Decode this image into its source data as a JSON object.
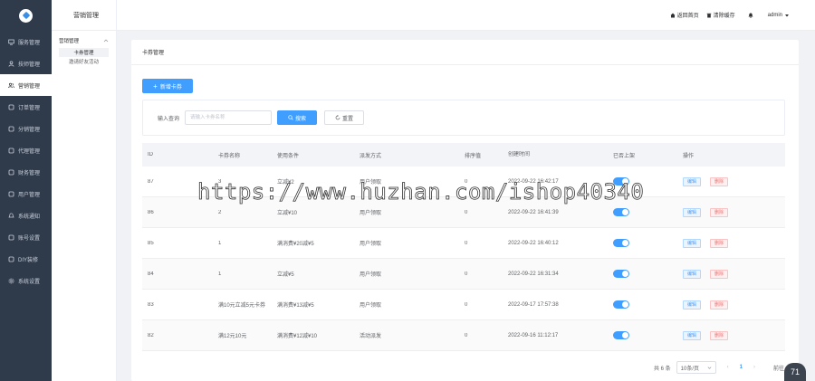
{
  "sidebar": {
    "items": [
      {
        "label": "服务管理",
        "icon": "monitor-icon"
      },
      {
        "label": "技师管理",
        "icon": "user-icon"
      },
      {
        "label": "营销管理",
        "icon": "people-icon",
        "active": true
      },
      {
        "label": "订单管理",
        "icon": "order-icon"
      },
      {
        "label": "分销管理",
        "icon": "share-icon"
      },
      {
        "label": "代理管理",
        "icon": "agent-icon"
      },
      {
        "label": "财务管理",
        "icon": "finance-icon"
      },
      {
        "label": "用户管理",
        "icon": "customer-icon"
      },
      {
        "label": "系统通知",
        "icon": "bell-icon"
      },
      {
        "label": "账号设置",
        "icon": "account-icon"
      },
      {
        "label": "DIY装修",
        "icon": "diy-icon"
      },
      {
        "label": "系统设置",
        "icon": "gear-icon"
      }
    ]
  },
  "submenu": {
    "title": "营销管理",
    "group": "营销管理",
    "links": [
      "卡券管理",
      "邀请好友活动"
    ]
  },
  "header": {
    "home": "返回首页",
    "clear_cache": "清除缓存",
    "user": "admin"
  },
  "content": {
    "title": "卡券管理",
    "add_button": "新增卡券",
    "search_label": "输入查询",
    "search_placeholder": "请输入卡券名称",
    "search_button": "搜索",
    "reset_button": "重置"
  },
  "table": {
    "headers": [
      "ID",
      "卡券名称",
      "使用条件",
      "派发方式",
      "排序值",
      "创建时间",
      "已否上架",
      "操作"
    ],
    "rows": [
      {
        "id": "87",
        "name": "3",
        "cond": "立减¥2",
        "claim": "用户领取",
        "sort": "0",
        "time": "2022-09-22 16:42:17"
      },
      {
        "id": "86",
        "name": "2",
        "cond": "立减¥10",
        "claim": "用户领取",
        "sort": "0",
        "time": "2022-09-22 16:41:39"
      },
      {
        "id": "85",
        "name": "1",
        "cond": "满消费¥20减¥5",
        "claim": "用户领取",
        "sort": "0",
        "time": "2022-09-22 16:40:12"
      },
      {
        "id": "84",
        "name": "1",
        "cond": "立减¥5",
        "claim": "用户领取",
        "sort": "0",
        "time": "2022-09-22 16:31:34"
      },
      {
        "id": "83",
        "name": "满10元立减5元卡券",
        "cond": "满消费¥13减¥5",
        "claim": "用户领取",
        "sort": "0",
        "time": "2022-09-17 17:57:38"
      },
      {
        "id": "82",
        "name": "满12元10元",
        "cond": "满消费¥12减¥10",
        "claim": "活动派发",
        "sort": "0",
        "time": "2022-09-16 11:12:17"
      }
    ],
    "edit_label": "编辑",
    "delete_label": "删除"
  },
  "pager": {
    "total": "共 6 条",
    "page_size": "10条/页",
    "current": "1",
    "goto": "前往"
  },
  "watermark": "https://www.huzhan.com/ishop40340",
  "badge": "71"
}
